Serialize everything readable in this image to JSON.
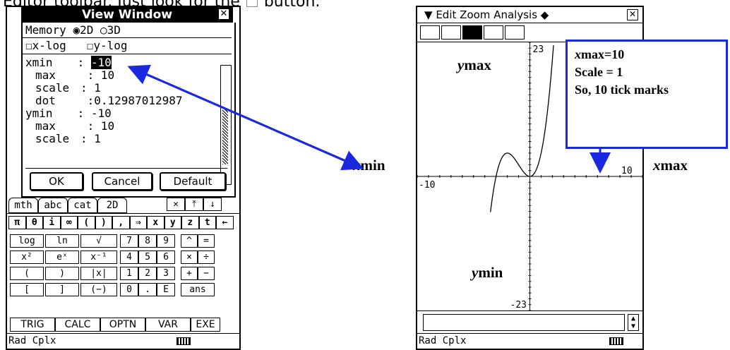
{
  "caption": {
    "before": "Editor toolbar. Just look for the",
    "after": "button."
  },
  "left": {
    "window_title": "View Window",
    "memory_label": "Memory",
    "opt_2d": "2D",
    "opt_3d": "3D",
    "xlog": "x-log",
    "ylog": "y-log",
    "fields": [
      {
        "label": "xmin",
        "value": "-10"
      },
      {
        "label": "max",
        "value": "10"
      },
      {
        "label": "scale",
        "value": "1"
      },
      {
        "label": "dot",
        "value": "0.12987012987"
      },
      {
        "label": "ymin",
        "value": "-10"
      },
      {
        "label": "max",
        "value": "10"
      },
      {
        "label": "scale",
        "value": "1"
      }
    ],
    "buttons": {
      "ok": "OK",
      "cancel": "Cancel",
      "default": "Default"
    },
    "tabs": [
      "mth",
      "abc",
      "cat",
      "2D"
    ],
    "sym_row": [
      "π",
      "θ",
      "i",
      "∞",
      "(",
      ")",
      ",",
      "⇒",
      "x",
      "y",
      "z",
      "t",
      "←"
    ],
    "keys": [
      [
        "log",
        "ln",
        "√",
        "7",
        "8",
        "9",
        "^",
        "="
      ],
      [
        "x²",
        "eˣ",
        "x⁻¹",
        "4",
        "5",
        "6",
        "×",
        "÷"
      ],
      [
        "(",
        ")",
        "|x|",
        "1",
        "2",
        "3",
        "+",
        "−"
      ],
      [
        "[",
        "]",
        "(−)",
        "0",
        ".",
        "E",
        "ans"
      ]
    ],
    "fkeys": [
      "TRIG",
      "CALC",
      "OPTN",
      "VAR",
      "EXE"
    ],
    "status": "Rad  Cplx"
  },
  "right": {
    "menu": [
      "Edit",
      "Zoom",
      "Analysis"
    ],
    "graph": {
      "ymax_label": "23",
      "ymin_label": "-23",
      "xmin_label": "-10",
      "xmax_label": "10"
    },
    "status": "Rad  Cplx"
  },
  "annotations": {
    "xmin": "min",
    "xmax": "max",
    "ymax": "max",
    "ymin": "min",
    "var_x": "x",
    "var_y": "y",
    "callout": [
      "max=10",
      "Scale = 1",
      "So, 10 tick marks"
    ]
  }
}
